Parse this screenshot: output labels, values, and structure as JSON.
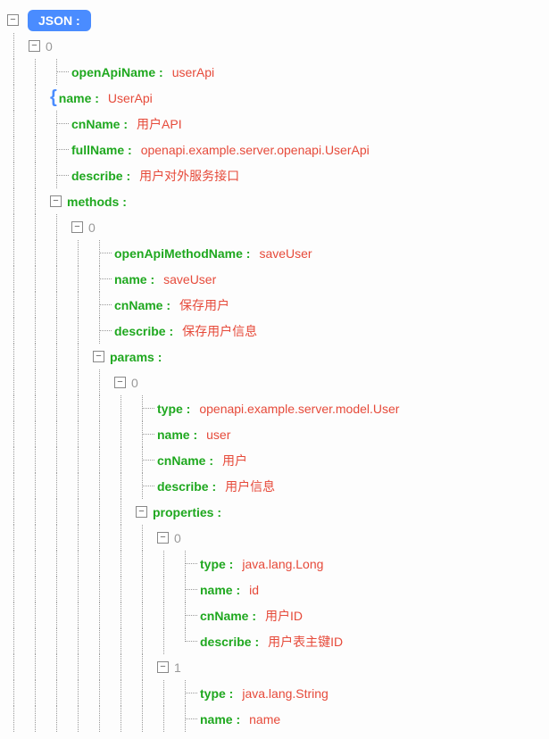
{
  "root": {
    "label": "JSON :"
  },
  "node0": {
    "index": "0",
    "openApiName": {
      "k": "openApiName :",
      "v": "userApi"
    },
    "name": {
      "k": "name :",
      "v": "UserApi"
    },
    "cnName": {
      "k": "cnName :",
      "v": "用户API"
    },
    "fullName": {
      "k": "fullName :",
      "v": "openapi.example.server.openapi.UserApi"
    },
    "describe": {
      "k": "describe :",
      "v": "用户对外服务接口"
    },
    "methods": {
      "k": "methods :"
    }
  },
  "method0": {
    "index": "0",
    "openApiMethodName": {
      "k": "openApiMethodName :",
      "v": "saveUser"
    },
    "name": {
      "k": "name :",
      "v": "saveUser"
    },
    "cnName": {
      "k": "cnName :",
      "v": "保存用户"
    },
    "describe": {
      "k": "describe :",
      "v": "保存用户信息"
    },
    "params": {
      "k": "params :"
    }
  },
  "param0": {
    "index": "0",
    "type": {
      "k": "type :",
      "v": "openapi.example.server.model.User"
    },
    "name": {
      "k": "name :",
      "v": "user"
    },
    "cnName": {
      "k": "cnName :",
      "v": "用户"
    },
    "describe": {
      "k": "describe :",
      "v": "用户信息"
    },
    "properties": {
      "k": "properties :"
    }
  },
  "prop0": {
    "index": "0",
    "type": {
      "k": "type :",
      "v": "java.lang.Long"
    },
    "name": {
      "k": "name :",
      "v": "id"
    },
    "cnName": {
      "k": "cnName :",
      "v": "用户ID"
    },
    "describe": {
      "k": "describe :",
      "v": "用户表主键ID"
    }
  },
  "prop1": {
    "index": "1",
    "type": {
      "k": "type :",
      "v": "java.lang.String"
    },
    "name": {
      "k": "name :",
      "v": "name"
    }
  }
}
